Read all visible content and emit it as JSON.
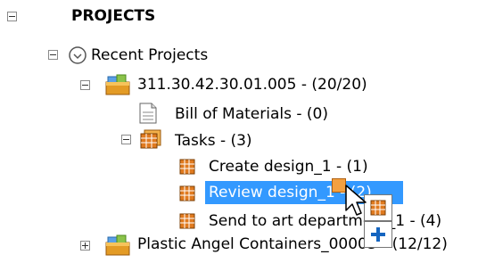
{
  "tree": {
    "root_label": "PROJECTS",
    "recent_label": "Recent Projects",
    "project1_label": "311.30.42.30.01.005 - (20/20)",
    "bom_label": "Bill of Materials - (0)",
    "tasks_label": "Tasks - (3)",
    "task1_label": "Create design_1 - (1)",
    "task2_label": "Review design_1 - (2)",
    "task3_label": "Send to art department_1 - (4)",
    "project2_label": "Plastic Angel Containers_00003 - (12/12)"
  },
  "colors": {
    "selection": "#3399ff",
    "calendar_orange": "#e07a1f",
    "drag_plus": "#1565c0"
  },
  "icons": {
    "recent": "clock-circle-icon",
    "project": "folder-box-icon",
    "bom": "document-icon",
    "tasks": "calendar-stack-icon",
    "task": "calendar-icon"
  }
}
